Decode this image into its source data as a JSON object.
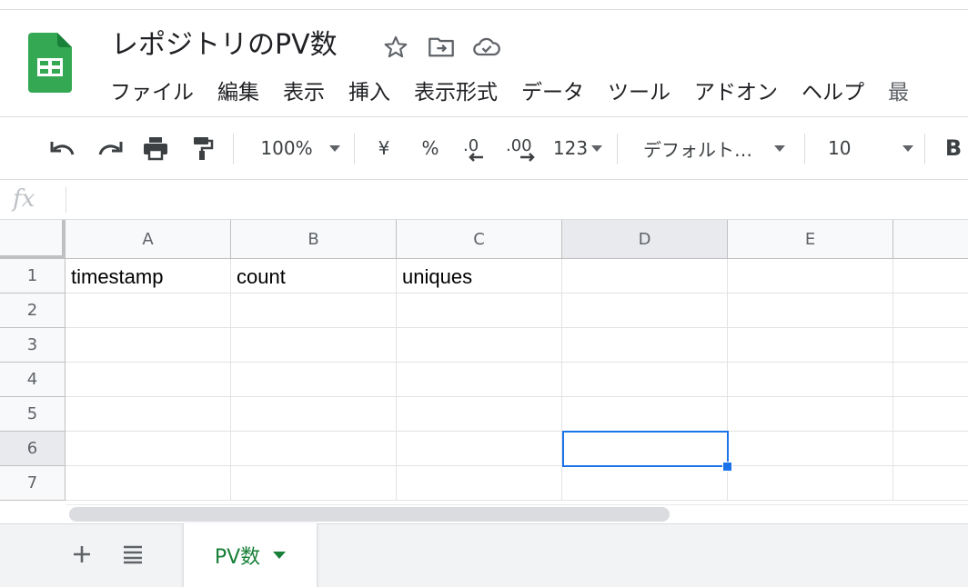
{
  "header": {
    "title": "レポジトリのPV数",
    "menu": [
      "ファイル",
      "編集",
      "表示",
      "挿入",
      "表示形式",
      "データ",
      "ツール",
      "アドオン",
      "ヘルプ",
      "最"
    ]
  },
  "toolbar": {
    "zoom": "100%",
    "currency": "¥",
    "percent": "%",
    "more_formats": "123",
    "font": "デフォルト…",
    "font_size": "10",
    "bold": "B"
  },
  "formula_bar": {
    "label": "fx",
    "value": ""
  },
  "grid": {
    "columns": [
      "A",
      "B",
      "C",
      "D",
      "E"
    ],
    "rows": [
      "1",
      "2",
      "3",
      "4",
      "5",
      "6",
      "7"
    ],
    "cells": [
      [
        "timestamp",
        "count",
        "uniques",
        "",
        ""
      ],
      [
        "",
        "",
        "",
        "",
        ""
      ],
      [
        "",
        "",
        "",
        "",
        ""
      ],
      [
        "",
        "",
        "",
        "",
        ""
      ],
      [
        "",
        "",
        "",
        "",
        ""
      ],
      [
        "",
        "",
        "",
        "",
        ""
      ],
      [
        "",
        "",
        "",
        "",
        ""
      ]
    ],
    "selected_cell": "D6"
  },
  "sheets": {
    "active_tab": "PV数"
  },
  "colors": {
    "accent": "#1a73e8",
    "sheet_green": "#188038",
    "logo_green": "#34a853"
  }
}
